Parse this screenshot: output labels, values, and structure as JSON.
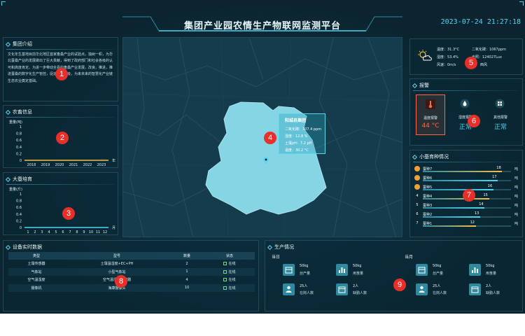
{
  "header": {
    "title": "集团产业园农情生产物联网监测平台",
    "datetime": "2023-07-24 21:27:18"
  },
  "intro": {
    "title": "集团介绍",
    "text": "文化年生基地目前华北地区首家畜桑产业的试验点，独树一帜，为华北蚕桑产业的发展做出了巨大贡献，得到了政府部门和社会各级的认可和高度肯定。为进一步带动全县的畜桑产业发展，改良，推进，推进蚕桑的数字化生产管控，促进产业升级，为来未来的智慧化产业链生态农业奠定基础。"
  },
  "agri_info": {
    "title": "农畜信息",
    "ylabel": "重量(吨)",
    "chart_data": {
      "type": "bar",
      "categories": [
        "2018",
        "2019",
        "2020",
        "2021",
        "2022",
        "2023"
      ],
      "values": [
        0,
        0,
        0,
        0,
        0,
        0
      ],
      "xlabel": "年",
      "ylabel": "重量(吨)",
      "ylim": [
        0,
        1
      ],
      "yticks": [
        "0",
        "0.2",
        "0.4",
        "0.6",
        "0.8",
        "1"
      ]
    }
  },
  "breeding": {
    "title": "大蚕培育",
    "ylabel": "重量(斤)",
    "chart_data": {
      "type": "bar",
      "categories": [
        "1",
        "2",
        "3",
        "4",
        "5",
        "6",
        "7",
        "8",
        "9",
        "10",
        "11",
        "12"
      ],
      "values": [
        0,
        0,
        0,
        0,
        0,
        0,
        0,
        0,
        0,
        0,
        0,
        0
      ],
      "xlabel": "月",
      "ylabel": "重量(斤)",
      "ylim": [
        0,
        1
      ],
      "yticks": [
        "0",
        "0.2",
        "0.4",
        "0.6",
        "0.8",
        "1"
      ]
    }
  },
  "map": {
    "tooltip": {
      "title": "阳城县集团",
      "rows": [
        "二氧化碳：307.4 ppm",
        "湿度：12.8 %",
        "土壤pH：7.2 pH",
        "温度：30.2 °C"
      ]
    }
  },
  "weather": {
    "icon": "partly-cloudy-icon",
    "temp": "温度：31.3°C",
    "humidity": "湿度：53.4%",
    "wind_speed": "风速：0m/s",
    "co2": "二氧化碳：1067ppm",
    "light": "光照：124027Lux",
    "wind_dir": "西风"
  },
  "alarm": {
    "title": "报警",
    "items": [
      {
        "label": "温度报警",
        "value": "44 °C",
        "color": "#ff6a3d",
        "icon": "thermometer-icon"
      },
      {
        "label": "湿度报警",
        "value": "正常",
        "color": "#4fd6f0",
        "icon": "humidity-icon"
      },
      {
        "label": "其他报警",
        "value": "正常",
        "color": "#4fd6f0",
        "icon": "grid-icon"
      }
    ]
  },
  "ranking": {
    "title": "小蚕育种情况",
    "unit": "吨",
    "items": [
      {
        "rank": "",
        "name": "蚕种7",
        "value": 18,
        "color": "#f0c04a"
      },
      {
        "rank": "",
        "name": "蚕种6",
        "value": 17,
        "color": "#4fd6f0"
      },
      {
        "rank": "",
        "name": "蚕种5",
        "value": 16,
        "color": "#4fd6f0"
      },
      {
        "rank": "4",
        "name": "蚕种4",
        "value": 15,
        "color": "#f0c04a"
      },
      {
        "rank": "5",
        "name": "蚕种3",
        "value": 14,
        "color": "#4fd6f0"
      },
      {
        "rank": "6",
        "name": "蚕种2",
        "value": 13,
        "color": "#4fd6f0"
      },
      {
        "rank": "7",
        "name": "蚕种1",
        "value": 12,
        "color": "#f0c04a"
      }
    ]
  },
  "devices": {
    "title": "设备实时数据",
    "columns": [
      "类型",
      "型号",
      "数量",
      "状态"
    ],
    "rows": [
      {
        "type": "土壤传感器",
        "model": "土壤温湿度+EC+PH",
        "count": "2",
        "status": "在线"
      },
      {
        "type": "气象站",
        "model": "小型气象站",
        "count": "1",
        "status": "在线"
      },
      {
        "type": "空气温湿度",
        "model": "空气温湿度传感器",
        "count": "4",
        "status": "在线"
      },
      {
        "type": "摄像机",
        "model": "海康摄像头",
        "count": "10",
        "status": "在线"
      }
    ]
  },
  "production": {
    "title": "生产情况",
    "groups": [
      {
        "label": "当日",
        "items": [
          {
            "value": "50kg",
            "label": "丝产量",
            "icon": "box-icon"
          },
          {
            "value": "50kg",
            "label": "用茧量",
            "icon": "bar-chart-icon"
          },
          {
            "value": "25人",
            "label": "在岗人数",
            "icon": "person-icon"
          },
          {
            "value": "2人",
            "label": "缺勤人数",
            "icon": "calendar-icon"
          }
        ]
      },
      {
        "label": "当月",
        "items": [
          {
            "value": "50kg",
            "label": "丝产量",
            "icon": "box-icon"
          },
          {
            "value": "50kg",
            "label": "用茧量",
            "icon": "bar-chart-icon"
          },
          {
            "value": "25人",
            "label": "在岗人数",
            "icon": "person-icon"
          },
          {
            "value": "2人",
            "label": "缺勤人数",
            "icon": "calendar-icon"
          }
        ]
      }
    ]
  },
  "markers": [
    "1",
    "2",
    "3",
    "4",
    "5",
    "6",
    "7",
    "8",
    "9"
  ]
}
